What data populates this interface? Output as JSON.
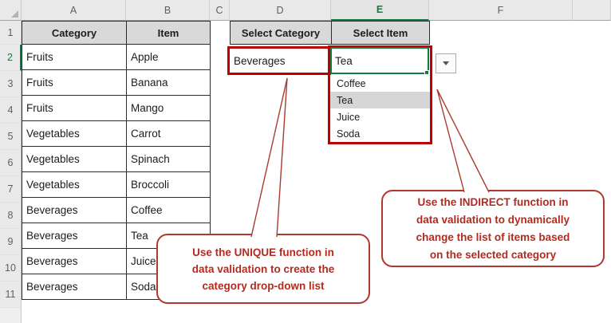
{
  "spreadsheet": {
    "column_letters": [
      "A",
      "B",
      "C",
      "D",
      "E",
      "F"
    ],
    "selected_column": "E",
    "row_numbers": [
      "1",
      "2",
      "3",
      "4",
      "5",
      "6",
      "7",
      "8",
      "9",
      "10",
      "11"
    ],
    "selected_row": "2",
    "table": {
      "headers": [
        "Category",
        "Item"
      ],
      "rows": [
        [
          "Fruits",
          "Apple"
        ],
        [
          "Fruits",
          "Banana"
        ],
        [
          "Fruits",
          "Mango"
        ],
        [
          "Vegetables",
          "Carrot"
        ],
        [
          "Vegetables",
          "Spinach"
        ],
        [
          "Vegetables",
          "Broccoli"
        ],
        [
          "Beverages",
          "Coffee"
        ],
        [
          "Beverages",
          "Tea"
        ],
        [
          "Beverages",
          "Juice"
        ],
        [
          "Beverages",
          "Soda"
        ]
      ]
    },
    "selectors": {
      "category_header": "Select Category",
      "item_header": "Select Item",
      "selected_category": "Beverages",
      "selected_item": "Tea"
    },
    "dropdown": {
      "items": [
        "Coffee",
        "Tea",
        "Juice",
        "Soda"
      ],
      "highlighted_item": "Tea",
      "arrow_icon": "dropdown-arrow"
    }
  },
  "callouts": {
    "unique": {
      "lines": [
        "Use the UNIQUE function in",
        "data validation to create the",
        "category drop-down list"
      ]
    },
    "indirect": {
      "lines": [
        "Use the INDIRECT function in",
        "data validation to dynamically",
        "change the list of items based",
        "on the selected category"
      ]
    }
  },
  "colors": {
    "annotation_red": "#C00000",
    "callout_border": "#AF392E",
    "callout_text": "#B32B1F",
    "excel_green": "#107C41",
    "header_cell_fill": "#D9D9D9",
    "chrome_fill": "#E9E9E9",
    "dropdown_highlight": "#D6D6D6"
  }
}
